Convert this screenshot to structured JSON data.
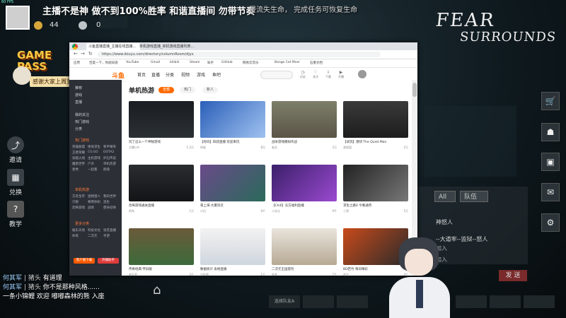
{
  "stream": {
    "title": "主播不是神 做不到100%胜率  和谐直播间  勿带节奏",
    "overlay_text": "侵流失生命，  完成任务可恢复生命",
    "gold_count": "44",
    "silver_count": "0",
    "corner_tag": "60 FPS",
    "logo_line1": "FEAR",
    "logo_line2": "SURROUNDS",
    "badge_line1": "GAME",
    "badge_line2": "PASS",
    "badge_banner": "感谢大家上周支持"
  },
  "left_menu": [
    {
      "icon": "share-icon",
      "label": "邀请"
    },
    {
      "icon": "qrcode-icon",
      "label": "兑换"
    },
    {
      "icon": "help-icon",
      "label": "教学"
    }
  ],
  "right_menu": [
    "cart-icon",
    "profile-icon",
    "backpack-icon",
    "mail-icon",
    "settings-icon"
  ],
  "browser": {
    "tabs": [
      "斗鱼直播直播_主播在线直播...",
      "单机游戏直播_单机游戏直播列表..."
    ],
    "url": "https://www.douyu.com/directory/columnRoom/djyx",
    "bookmarks": [
      "应用",
      "百度一下，你就知道",
      "YouTube",
      "Gmail",
      "bilibili",
      "Steam",
      "知乎",
      "GitHub",
      "网易云音乐",
      "Bongo Cat Mver",
      "石墨文档"
    ],
    "brand": "斗鱼",
    "nav": [
      "首页",
      "直播",
      "分类",
      "视频",
      "游戏",
      "鱼吧"
    ],
    "nav_icons": [
      {
        "icon": "history-icon",
        "label": "历史"
      },
      {
        "icon": "follow-icon",
        "label": "关注"
      },
      {
        "icon": "download-icon",
        "label": "下载"
      },
      {
        "icon": "live-icon",
        "label": "开播"
      }
    ]
  },
  "sidebar": {
    "top": [
      "推荐",
      "游戏",
      "直播"
    ],
    "items": [
      "我的关注",
      "热门游戏",
      "分类"
    ],
    "heading": "热门游戏",
    "games": [
      "英雄联盟",
      "绝地求生",
      "和平精英",
      "王者荣耀",
      "CS:GO",
      "DOTA2",
      "穿越火线",
      "主机游戏",
      "炉石传说",
      "魔兽世界",
      "户外",
      "单机热游",
      "星秀",
      "一起看",
      "颜值"
    ],
    "heading2": "单机热游",
    "games2": [
      "方舟生存",
      "怪物猎人",
      "我的世界",
      "只狼",
      "黎明杀机",
      "逃生",
      "恐怖游戏",
      "战地",
      "使命召唤"
    ],
    "heading3": "更多分类",
    "games3": [
      "娱乐天地",
      "科技文化",
      "语音直播",
      "体育",
      "二次元",
      "手游"
    ],
    "btn_left": "客户端下载",
    "btn_right": "开播助手"
  },
  "content": {
    "section_title": "单机热游",
    "filters": [
      "全部",
      "热门",
      "新人"
    ],
    "cards": [
      {
        "title": "玩了这么一个神秘游戏",
        "host": "主播小A",
        "count": "1.2万"
      },
      {
        "title": "【有码】四叔直播 欢迎来玩",
        "host": "四叔",
        "count": "8万"
      },
      {
        "title": "战争游戏模拟作战",
        "host": "老兵",
        "count": "3万"
      },
      {
        "title": "【试玩】潜伏·The Quiet Man",
        "host": "游戏君",
        "count": "2万"
      },
      {
        "title": "恐怖游戏通关直播",
        "host": "阿布",
        "count": "1万"
      },
      {
        "title": "夜上海·大厦风云",
        "host": "小白",
        "count": "6千"
      },
      {
        "title": "【Chill】东方福利直播",
        "host": "二次元",
        "count": "9千"
      },
      {
        "title": "求生之路4 今晚通宵",
        "host": "三哥",
        "count": "5万"
      },
      {
        "title": "传奇经典 怀旧服",
        "host": "老玩家",
        "count": "3千"
      },
      {
        "title": "数据统计 表格直播",
        "host": "分析师",
        "count": "1千"
      },
      {
        "title": "二次元王国冒险",
        "host": "苏苏",
        "count": "7千"
      },
      {
        "title": "BD若竹 每日精彩",
        "host": "若竹",
        "count": "4万"
      }
    ]
  },
  "chat": {
    "tab_all": "All",
    "tab_team": "队伍",
    "lines": [
      "神怒人",
      "--大道牢--监狱--怒人",
      "加入",
      "加入"
    ],
    "send_label": "发 送"
  },
  "danmaku": [
    {
      "user": "何其军",
      "sep": "|",
      "sep2": "猪头",
      "msg": "有道理"
    },
    {
      "user": "何其军",
      "sep": "|",
      "sep2": "猪头",
      "msg": "你不是那种风格......"
    },
    {
      "user": "一条小锦鲤",
      "sep": "",
      "sep2": "",
      "msg": "欢迎 嘟嘟森林的熊 入座"
    }
  ],
  "bottom_slot": "选择队友A"
}
